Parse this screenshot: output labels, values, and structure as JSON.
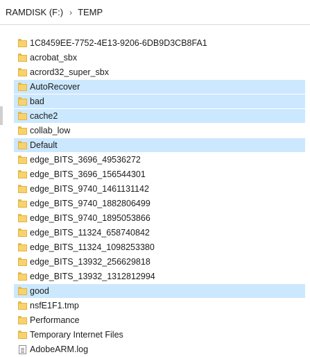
{
  "breadcrumb": {
    "drive": "RAMDISK (F:)",
    "separator": "›",
    "folder": "TEMP"
  },
  "files": [
    {
      "name": "1C8459EE-7752-4E13-9206-6DB9D3CB8FA1",
      "icon": "folder-icon",
      "selected": false
    },
    {
      "name": "acrobat_sbx",
      "icon": "folder-icon",
      "selected": false
    },
    {
      "name": "acrord32_super_sbx",
      "icon": "folder-icon",
      "selected": false
    },
    {
      "name": "AutoRecover",
      "icon": "folder-icon",
      "selected": true
    },
    {
      "name": "bad",
      "icon": "folder-icon",
      "selected": true
    },
    {
      "name": "cache2",
      "icon": "folder-icon",
      "selected": true
    },
    {
      "name": "collab_low",
      "icon": "folder-icon",
      "selected": false
    },
    {
      "name": "Default",
      "icon": "folder-icon",
      "selected": true
    },
    {
      "name": "edge_BITS_3696_49536272",
      "icon": "folder-icon",
      "selected": false
    },
    {
      "name": "edge_BITS_3696_156544301",
      "icon": "folder-icon",
      "selected": false
    },
    {
      "name": "edge_BITS_9740_1461131142",
      "icon": "folder-icon",
      "selected": false
    },
    {
      "name": "edge_BITS_9740_1882806499",
      "icon": "folder-icon",
      "selected": false
    },
    {
      "name": "edge_BITS_9740_1895053866",
      "icon": "folder-icon",
      "selected": false
    },
    {
      "name": "edge_BITS_11324_658740842",
      "icon": "folder-icon",
      "selected": false
    },
    {
      "name": "edge_BITS_11324_1098253380",
      "icon": "folder-icon",
      "selected": false
    },
    {
      "name": "edge_BITS_13932_256629818",
      "icon": "folder-icon",
      "selected": false
    },
    {
      "name": "edge_BITS_13932_1312812994",
      "icon": "folder-icon",
      "selected": false
    },
    {
      "name": "good",
      "icon": "folder-icon",
      "selected": true
    },
    {
      "name": "nsfE1F1.tmp",
      "icon": "folder-icon",
      "selected": false
    },
    {
      "name": "Performance",
      "icon": "folder-icon",
      "selected": false
    },
    {
      "name": "Temporary Internet Files",
      "icon": "folder-icon",
      "selected": false
    },
    {
      "name": "AdobeARM.log",
      "icon": "log-file-icon",
      "selected": false
    }
  ],
  "colors": {
    "selection": "#cce8ff",
    "folder": "#f7d36e",
    "folder_border": "#e3b340"
  }
}
